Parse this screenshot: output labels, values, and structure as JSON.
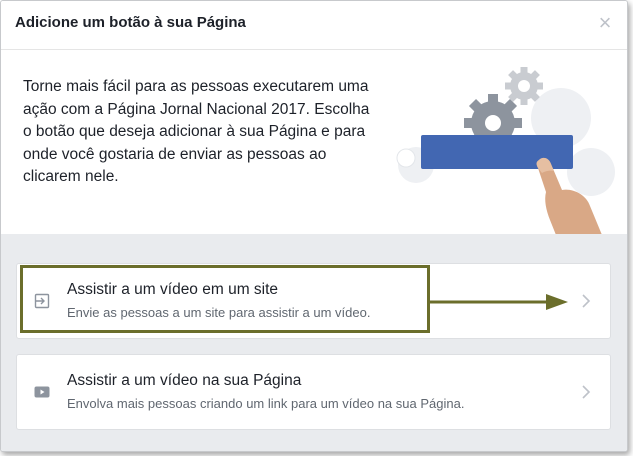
{
  "dialog": {
    "title": "Adicione um botão à sua Página",
    "close_glyph": "×"
  },
  "intro": {
    "text": "Torne mais fácil para as pessoas executarem uma ação com a Página Jornal Nacional 2017. Escolha o botão que deseja adicionar à sua Página e para onde você gostaria de enviar as pessoas ao clicarem nele."
  },
  "options": [
    {
      "title": "Assistir a um vídeo em um site",
      "subtitle": "Envie as pessoas a um site para assistir a um vídeo.",
      "icon": "external-link-icon",
      "highlighted": true
    },
    {
      "title": "Assistir a um vídeo na sua Página",
      "subtitle": "Envolva mais pessoas criando um link para um vídeo na sua Página.",
      "icon": "video-play-icon",
      "highlighted": false
    }
  ],
  "colors": {
    "accent_blue": "#4267b2",
    "annotation_olive": "#6b6e2b",
    "options_bg": "#e9ebee"
  }
}
